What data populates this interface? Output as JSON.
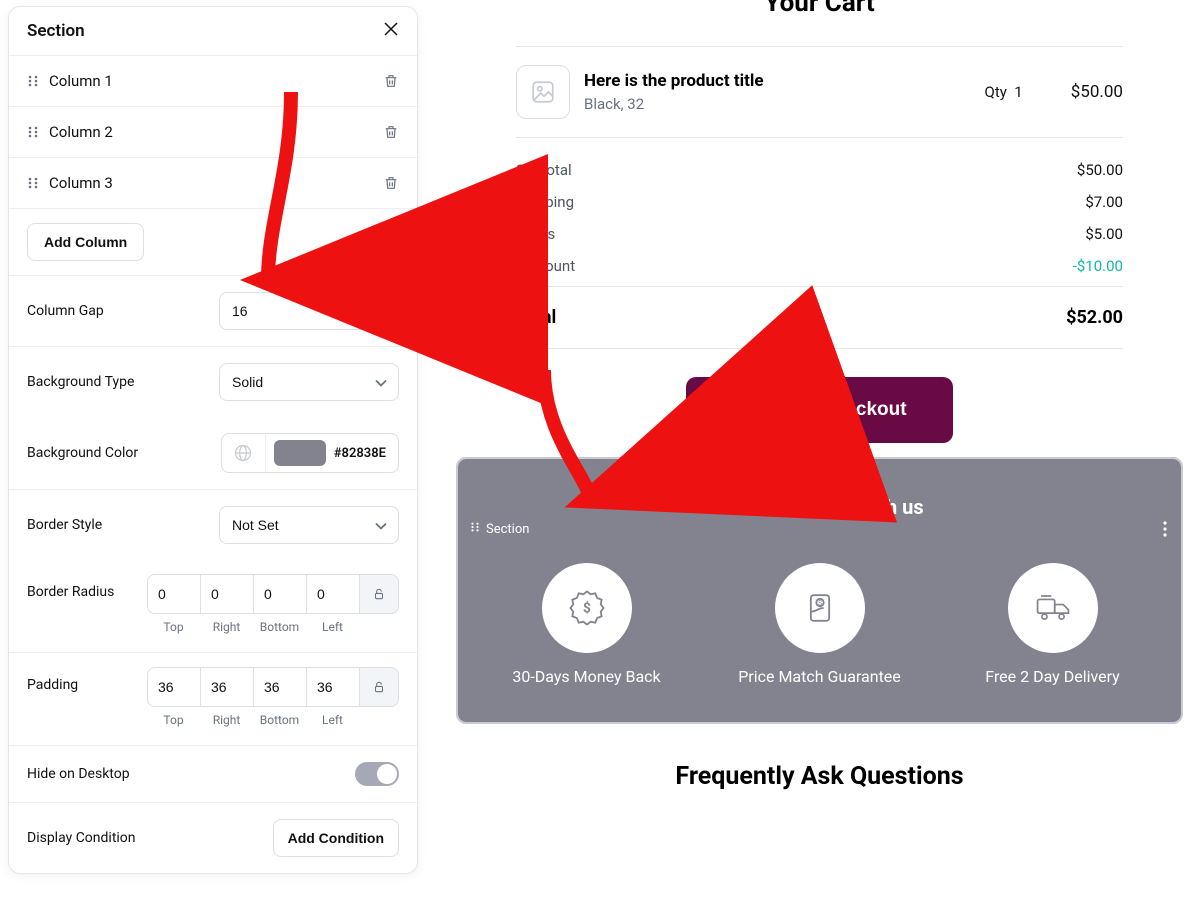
{
  "sidebar": {
    "title": "Section",
    "columns": [
      {
        "label": "Column 1"
      },
      {
        "label": "Column 2"
      },
      {
        "label": "Column 3"
      }
    ],
    "add_column_label": "Add Column",
    "column_gap": {
      "label": "Column Gap",
      "value": "16"
    },
    "background_type": {
      "label": "Background Type",
      "value": "Solid"
    },
    "background_color": {
      "label": "Background Color",
      "hex": "#82838E"
    },
    "border_style": {
      "label": "Border Style",
      "value": "Not Set"
    },
    "border_radius": {
      "label": "Border Radius",
      "values": {
        "top": "0",
        "right": "0",
        "bottom": "0",
        "left": "0"
      },
      "sublabels": {
        "top": "Top",
        "right": "Right",
        "bottom": "Bottom",
        "left": "Left"
      }
    },
    "padding": {
      "label": "Padding",
      "values": {
        "top": "36",
        "right": "36",
        "bottom": "36",
        "left": "36"
      },
      "sublabels": {
        "top": "Top",
        "right": "Right",
        "bottom": "Bottom",
        "left": "Left"
      }
    },
    "hide_desktop": {
      "label": "Hide on Desktop",
      "value": false
    },
    "display_condition": {
      "label": "Display Condition",
      "button": "Add Condition"
    }
  },
  "preview": {
    "cart_title": "Your Cart",
    "item": {
      "title": "Here is the product title",
      "subtitle": "Black, 32",
      "qty_label": "Qty",
      "qty_value": "1",
      "price": "$50.00"
    },
    "totals": {
      "subtotal_label": "Subtotal",
      "subtotal_value": "$50.00",
      "shipping_label": "Shipping",
      "shipping_value": "$7.00",
      "taxes_label": "Taxes",
      "taxes_value": "$5.00",
      "discount_label": "Discount",
      "discount_value": "-$10.00",
      "total_label": "Total",
      "total_value": "$52.00"
    },
    "checkout_label": "Continue Checkout",
    "reason": {
      "title": "Reason to shop with us",
      "tag": "Section",
      "cols": [
        {
          "label": "30-Days Money Back"
        },
        {
          "label": "Price Match Guarantee"
        },
        {
          "label": "Free 2 Day Delivery"
        }
      ]
    },
    "faq_title": "Frequently Ask Questions"
  }
}
